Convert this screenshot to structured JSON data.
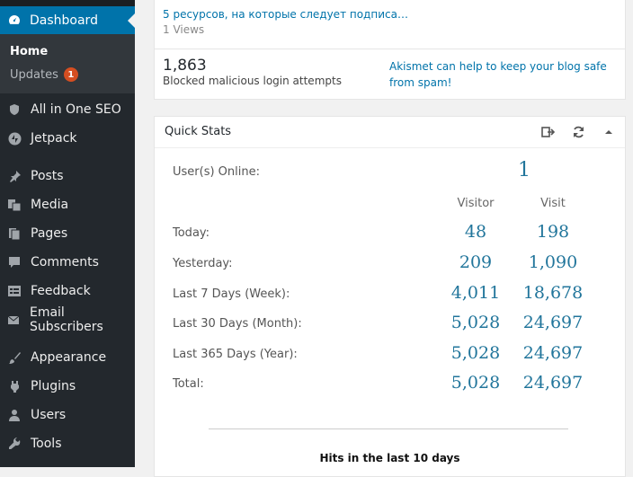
{
  "sidebar": {
    "dashboard_label": "Dashboard",
    "submenu": {
      "home": "Home",
      "updates": "Updates",
      "updates_badge": "1"
    },
    "items": [
      {
        "label": "All in One SEO",
        "icon": "shield-icon"
      },
      {
        "label": "Jetpack",
        "icon": "jetpack-icon"
      },
      {
        "label": "Posts",
        "icon": "pin-icon"
      },
      {
        "label": "Media",
        "icon": "media-icon"
      },
      {
        "label": "Pages",
        "icon": "pages-icon"
      },
      {
        "label": "Comments",
        "icon": "comment-icon"
      },
      {
        "label": "Feedback",
        "icon": "feedback-icon"
      },
      {
        "label": "Email Subscribers",
        "icon": "email-icon"
      },
      {
        "label": "Appearance",
        "icon": "paintbrush-icon"
      },
      {
        "label": "Plugins",
        "icon": "plugin-icon"
      },
      {
        "label": "Users",
        "icon": "users-icon"
      },
      {
        "label": "Tools",
        "icon": "wrench-icon"
      }
    ]
  },
  "top_post": {
    "link": "5 ресурсов, на которые следует подписа…",
    "views": "1 Views"
  },
  "security": {
    "count": "1,863",
    "description": "Blocked malicious login attempts",
    "akismet": "Akismet can help to keep your blog safe from spam!"
  },
  "quick_stats": {
    "title": "Quick Stats",
    "online_label": "User(s) Online:",
    "online_value": "1",
    "col_visitor": "Visitor",
    "col_visit": "Visit",
    "rows": [
      {
        "label": "Today:",
        "visitor": "48",
        "visit": "198"
      },
      {
        "label": "Yesterday:",
        "visitor": "209",
        "visit": "1,090"
      },
      {
        "label": "Last 7 Days (Week):",
        "visitor": "4,011",
        "visit": "18,678"
      },
      {
        "label": "Last 30 Days (Month):",
        "visitor": "5,028",
        "visit": "24,697"
      },
      {
        "label": "Last 365 Days (Year):",
        "visitor": "5,028",
        "visit": "24,697"
      },
      {
        "label": "Total:",
        "visitor": "5,028",
        "visit": "24,697"
      }
    ],
    "chart_title": "Hits in the last 10 days"
  },
  "colors": {
    "sidebar": "#23282d",
    "active": "#0073aa",
    "link": "#0073aa",
    "stat": "#21759b",
    "badge": "#d54e21"
  }
}
